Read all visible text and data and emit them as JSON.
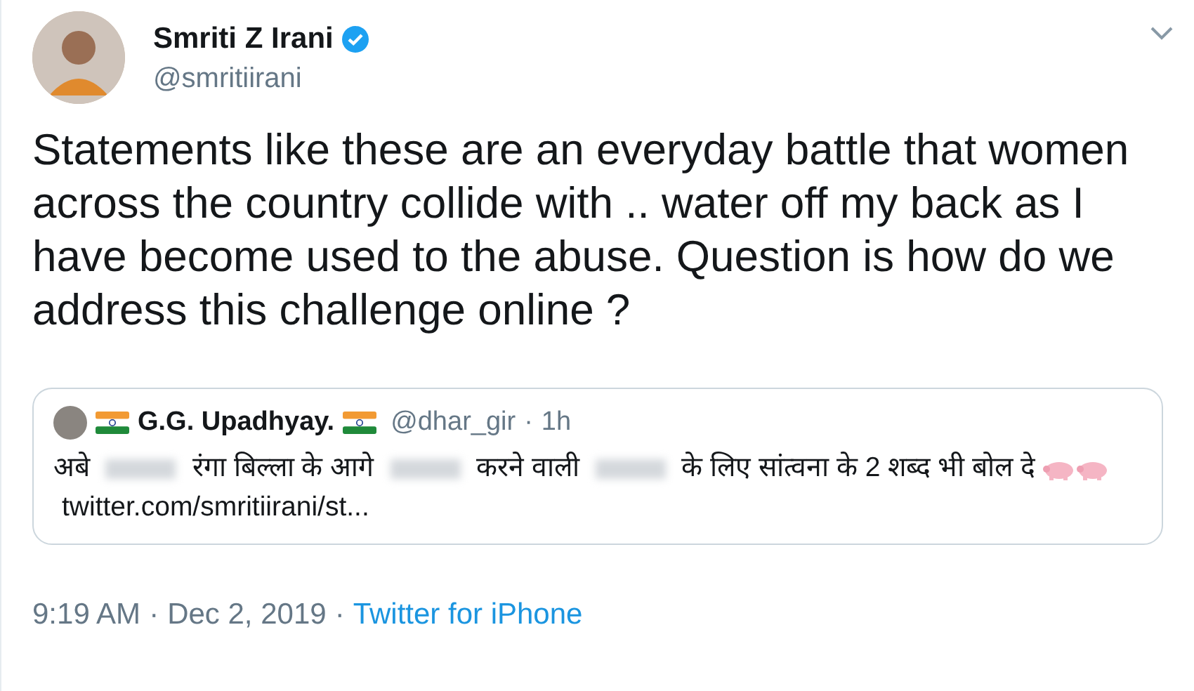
{
  "author": {
    "name": "Smriti Z Irani",
    "handle": "@smritiirani",
    "verified": true
  },
  "text": "Statements like these are an everyday battle that women across the country collide with .. water off my back as I have become used to the abuse. Question is how do we address this challenge online ?",
  "quoted": {
    "name": "G.G. Upadhyay.",
    "handle": "@dhar_gir",
    "separator": "·",
    "time": "1h",
    "body": [
      {
        "kind": "text",
        "text": "अबे"
      },
      {
        "kind": "redacted"
      },
      {
        "kind": "text",
        "text": "रंगा बिल्ला के आगे"
      },
      {
        "kind": "redacted"
      },
      {
        "kind": "text",
        "text": "करने वाली"
      },
      {
        "kind": "redacted"
      },
      {
        "kind": "text",
        "text": "के लिए सांत्वना के 2 शब्द भी बोल दे"
      },
      {
        "kind": "pig"
      },
      {
        "kind": "pig"
      },
      {
        "kind": "link",
        "text": "twitter.com/smritiirani/st..."
      }
    ]
  },
  "footer": {
    "time": "9:19 AM",
    "separator_1": "·",
    "date": "Dec 2, 2019",
    "separator_2": "·",
    "source": "Twitter for iPhone"
  }
}
